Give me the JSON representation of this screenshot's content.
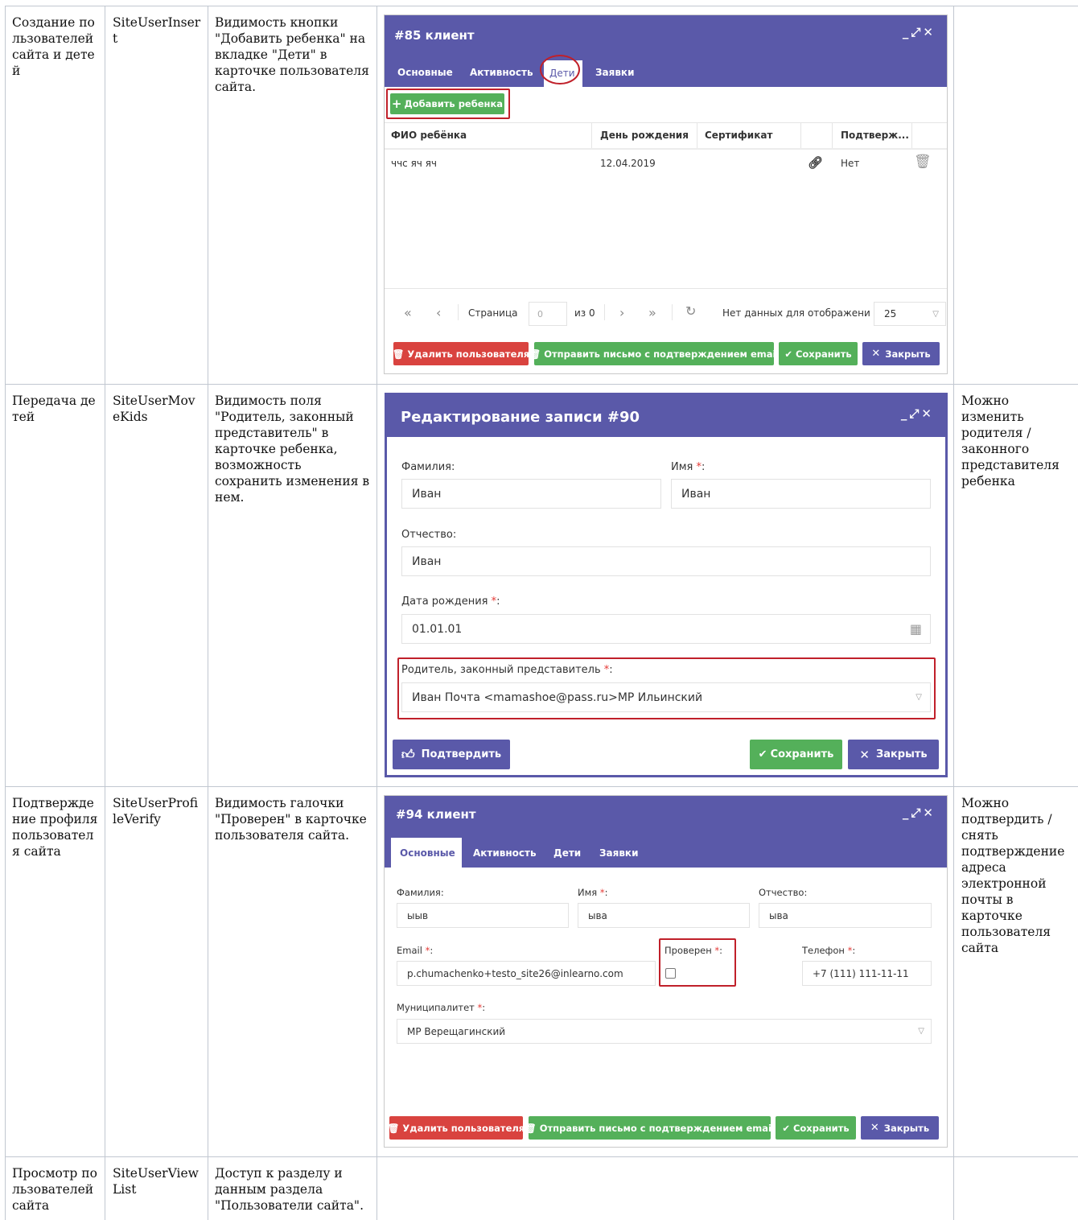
{
  "rows": [
    {
      "name": "Создание пользователей сайта и детей",
      "code": "SiteUserInsert",
      "description": "Видимость кнопки \"Добавить ребенка\" на вкладке \"Дети\" в карточке пользователя сайта.",
      "note": ""
    },
    {
      "name": "Передача детей",
      "code": "SiteUserMoveKids",
      "description": "Видимость поля \"Родитель, законный представитель\" в карточке ребенка, возможность сохранить изменения в нем.",
      "note": "Можно изменить родителя /законного представителя ребенка"
    },
    {
      "name": "Подтверждение профиля пользователя сайта",
      "code": "SiteUserProfileVerify",
      "description": "Видимость галочки \"Проверен\" в карточке пользователя сайта.",
      "note": "Можно подтвердить /снять подтверждение адреса электронной почты в карточке пользователя сайта"
    },
    {
      "name": "Просмотр пользователей сайта",
      "code": "SiteUserViewList",
      "description": "Доступ к разделу и данным раздела \"Пользователи сайта\".",
      "note": ""
    }
  ],
  "shot1": {
    "title": "#85 клиент",
    "tabs": [
      "Основные",
      "Активность",
      "Дети",
      "Заявки"
    ],
    "add_button": "Добавить ребенка",
    "columns": [
      "ФИО ребёнка",
      "День рождения",
      "Сертификат",
      "",
      "Подтверж..."
    ],
    "row": {
      "name": "ччс яч яч",
      "birthday": "12.04.2019",
      "verified": "Нет"
    },
    "pager": {
      "page_label": "Страница",
      "page": "0",
      "of": "из 0",
      "empty": "Нет данных для отображения",
      "size": "25"
    },
    "buttons": {
      "delete": "Удалить пользователя",
      "send": "Отправить письмо с подтверждением email",
      "save": "Сохранить",
      "close": "Закрыть"
    }
  },
  "shot2": {
    "title": "Редактирование записи #90",
    "surname_label": "Фамилия:",
    "surname": "Иван",
    "name_label": "Имя",
    "name": "Иван",
    "patronymic_label": "Отчество:",
    "patronymic": "Иван",
    "birth_label": "Дата рождения",
    "birth": "01.01.01",
    "parent_label": "Родитель, законный представитель",
    "parent": "Иван Почта <mamashoe@pass.ru>МР Ильинский",
    "buttons": {
      "confirm": "Подтвердить",
      "save": "Сохранить",
      "close": "Закрыть"
    }
  },
  "shot3": {
    "title": "#94 клиент",
    "tabs": [
      "Основные",
      "Активность",
      "Дети",
      "Заявки"
    ],
    "surname_label": "Фамилия:",
    "surname": "ыыв",
    "name_label": "Имя",
    "name": "ыва",
    "patronymic_label": "Отчество:",
    "patronymic": "ыва",
    "email_label": "Email",
    "email": "p.chumachenko+testo_site26@inlearno.com",
    "verified_label": "Проверен",
    "phone_label": "Телефон",
    "phone": "+7 (111) 111-11-11",
    "municipality_label": "Муниципалитет",
    "municipality": "МР Верещагинский",
    "buttons": {
      "delete": "Удалить пользователя",
      "send": "Отправить письмо с подтверждением email",
      "save": "Сохранить",
      "close": "Закрыть"
    }
  }
}
